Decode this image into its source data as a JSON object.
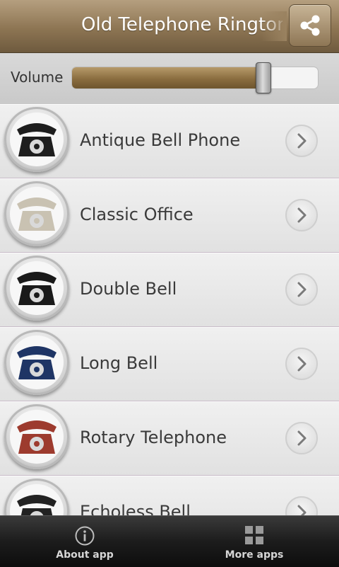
{
  "header": {
    "title": "Old Telephone Ringtones",
    "share_icon": "share-icon"
  },
  "volume": {
    "label": "Volume",
    "level": 0.78
  },
  "list": {
    "items": [
      {
        "label": "Antique Bell Phone",
        "icon": "black-rotary-phone",
        "phone_color": "#1e1e1e"
      },
      {
        "label": "Classic Office",
        "icon": "beige-office-phone",
        "phone_color": "#c9c2b2"
      },
      {
        "label": "Double Bell",
        "icon": "black-double-bell-phone",
        "phone_color": "#1a1a1a"
      },
      {
        "label": "Long Bell",
        "icon": "blue-rotary-phone",
        "phone_color": "#1f3565"
      },
      {
        "label": "Rotary Telephone",
        "icon": "red-rotary-phone",
        "phone_color": "#9d3b2e"
      },
      {
        "label": "Echoless Bell",
        "icon": "black-rotary-phone",
        "phone_color": "#222222"
      }
    ]
  },
  "bottom_bar": {
    "about": {
      "label": "About app",
      "icon": "info-icon"
    },
    "more": {
      "label": "More apps",
      "icon": "grid-icon"
    }
  }
}
